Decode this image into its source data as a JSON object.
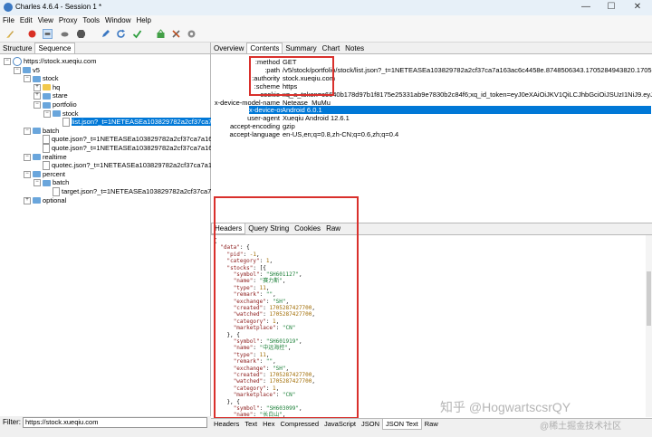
{
  "window": {
    "title": "Charles 4.6.4 - Session 1 *",
    "minimize": "—",
    "maximize": "☐",
    "close": "✕"
  },
  "menu": [
    "File",
    "Edit",
    "View",
    "Proxy",
    "Tools",
    "Window",
    "Help"
  ],
  "left": {
    "tabs": [
      "Structure",
      "Sequence"
    ],
    "tree": [
      {
        "label": "https://stock.xueqiu.com",
        "icon": "globe",
        "indent": 0,
        "exp": "−"
      },
      {
        "label": "v5",
        "icon": "folder",
        "indent": 1,
        "exp": "−"
      },
      {
        "label": "stock",
        "icon": "folder",
        "indent": 2,
        "exp": "−"
      },
      {
        "label": "hq",
        "icon": "folder-hq",
        "indent": 3,
        "exp": "+"
      },
      {
        "label": "stare",
        "icon": "folder",
        "indent": 3,
        "exp": "+"
      },
      {
        "label": "portfolio",
        "icon": "folder",
        "indent": 3,
        "exp": "−"
      },
      {
        "label": "stock",
        "icon": "folder",
        "indent": 4,
        "exp": "−"
      },
      {
        "label": "list.json?_t=1NETEASEa103829782a2cf37ca7a163ac",
        "icon": "doc",
        "indent": 5,
        "exp": "",
        "selected": true
      },
      {
        "label": "batch",
        "icon": "folder",
        "indent": 2,
        "exp": "−"
      },
      {
        "label": "quote.json?_t=1NETEASEa103829782a2cf37ca7a163ac",
        "icon": "doc",
        "indent": 3,
        "exp": ""
      },
      {
        "label": "quote.json?_t=1NETEASEa103829782a2cf37ca7a163ac",
        "icon": "doc",
        "indent": 3,
        "exp": ""
      },
      {
        "label": "realtime",
        "icon": "folder",
        "indent": 2,
        "exp": "−"
      },
      {
        "label": "quotec.json?_t=1NETEASEa103829782a2cf37ca7a163ac",
        "icon": "doc",
        "indent": 3,
        "exp": ""
      },
      {
        "label": "percent",
        "icon": "folder",
        "indent": 2,
        "exp": "−"
      },
      {
        "label": "batch",
        "icon": "folder",
        "indent": 3,
        "exp": "−"
      },
      {
        "label": "target.json?_t=1NETEASEa103829782a2cf37ca7a16",
        "icon": "doc",
        "indent": 4,
        "exp": ""
      },
      {
        "label": "optional",
        "icon": "folder",
        "indent": 2,
        "exp": "+"
      }
    ],
    "filter_label": "Filter:",
    "filter_value": "https://stock.xueqiu.com"
  },
  "right": {
    "tabs": [
      "Overview",
      "Contents",
      "Summary",
      "Chart",
      "Notes"
    ],
    "active_tab": "Contents",
    "headers": [
      {
        "name": ":method",
        "value": "GET"
      },
      {
        "name": ":path",
        "value": "/v5/stock/portfolio/stock/list.json?_t=1NETEASEa103829782a2cf37ca7a163ac6c4458e.8748506343.1705284943820.1705287593111..."
      },
      {
        "name": ":authority",
        "value": "stock.xueqiu.com"
      },
      {
        "name": ":scheme",
        "value": "https"
      },
      {
        "name": "cookie",
        "value": "xq_a_token=c6640b178d97b1f8175e25331ab9e7830b2c84f6;xq_id_token=eyJ0eXAiOiJKV1QiLCJhbGciOiJSUzI1NiJ9.eyJ1aWQiOjg..."
      },
      {
        "name": "x-device-model-name",
        "value": "Netease_MuMu"
      },
      {
        "name": "x-device-os",
        "value": "Android 6.0.1",
        "selected": true
      },
      {
        "name": "user-agent",
        "value": "Xueqiu Android 12.6.1"
      },
      {
        "name": "accept-encoding",
        "value": "gzip"
      },
      {
        "name": "accept-language",
        "value": "en-US,en;q=0.8,zh-CN;q=0.6,zh;q=0.4"
      }
    ],
    "body_tabs": [
      "Headers",
      "Query String",
      "Cookies",
      "Raw"
    ],
    "json_lines": [
      "{",
      "  \"data\": {",
      "    \"pid\": -1,",
      "    \"category\": 1,",
      "    \"stocks\": [{",
      "      \"symbol\": \"SH601127\",",
      "      \"name\": \"赛力斯\",",
      "      \"type\": 11,",
      "      \"remark\": \"\",",
      "      \"exchange\": \"SH\",",
      "      \"created\": 1705287427700,",
      "      \"watched\": 1705287427700,",
      "      \"category\": 1,",
      "      \"marketplace\": \"CN\"",
      "    }, {",
      "      \"symbol\": \"SH601919\",",
      "      \"name\": \"中远海控\",",
      "      \"type\": 11,",
      "      \"remark\": \"\",",
      "      \"exchange\": \"SH\",",
      "      \"created\": 1705287427700,",
      "      \"watched\": 1705287427700,",
      "      \"category\": 1,",
      "      \"marketplace\": \"CN\"",
      "    }, {",
      "      \"symbol\": \"SH603099\",",
      "      \"name\": \"长白山\","
    ],
    "bottom_tabs": [
      "Headers",
      "Text",
      "Hex",
      "Compressed",
      "JavaScript",
      "JSON",
      "JSON Text",
      "Raw"
    ],
    "active_bottom_tab": "JSON Text"
  },
  "watermark": {
    "line1": "知乎 @HogwartscsrQY",
    "line2": "@稀土掘金技术社区"
  },
  "colors": {
    "accent": "#0078d7",
    "highlight": "#d9302c"
  }
}
